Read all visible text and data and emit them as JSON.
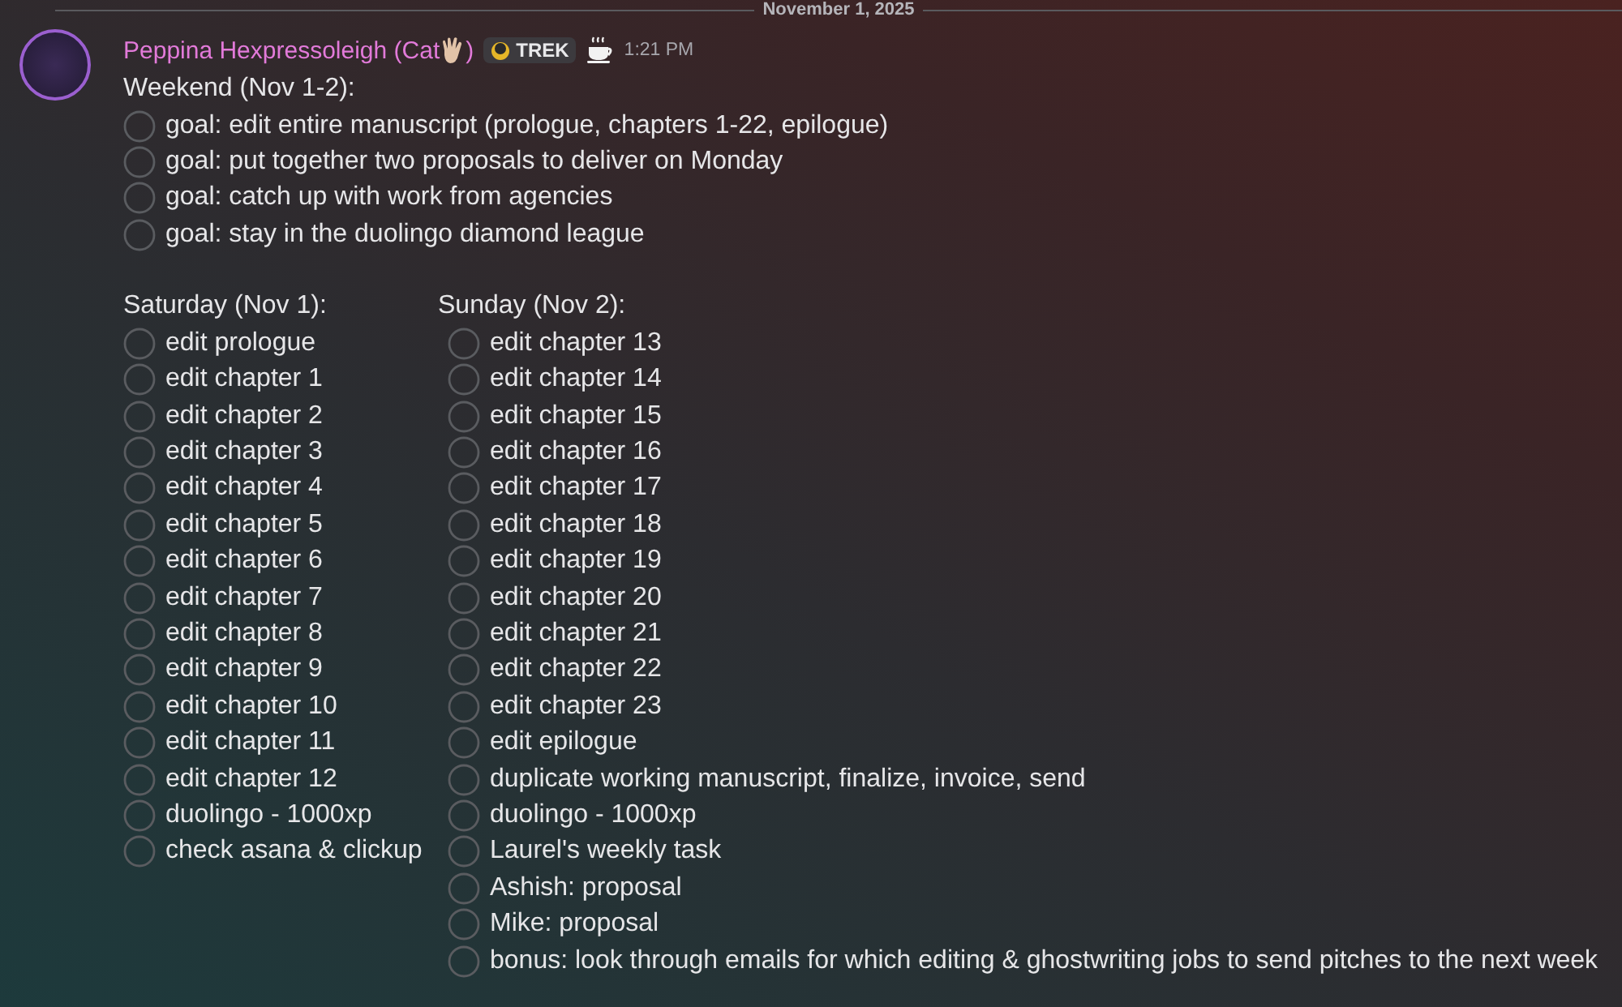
{
  "date_divider": "November 1, 2025",
  "message": {
    "author": "Peppina Hexpressoleigh (Cat",
    "author_end": ")",
    "tag": "TREK",
    "time": "1:21 PM",
    "heading": "Weekend (Nov 1-2):",
    "goals": [
      "goal: edit entire manuscript (prologue, chapters 1-22, epilogue)",
      "goal: put together two proposals to deliver on Monday",
      "goal: catch up with work from agencies",
      "goal: stay in the duolingo diamond league"
    ],
    "columns": [
      {
        "heading": "Saturday (Nov 1):",
        "items": [
          "edit prologue",
          "edit chapter 1",
          "edit chapter 2",
          "edit chapter 3",
          "edit chapter 4",
          "edit chapter 5",
          "edit chapter 6",
          "edit chapter 7",
          "edit chapter 8",
          "edit chapter 9",
          "edit chapter 10",
          "edit chapter 11",
          "edit chapter 12",
          "duolingo - 1000xp",
          "check asana & clickup"
        ]
      },
      {
        "heading": "Sunday (Nov 2):",
        "items": [
          "edit chapter 13",
          "edit chapter 14",
          "edit chapter 15",
          "edit chapter 16",
          "edit chapter 17",
          "edit chapter 18",
          "edit chapter 19",
          "edit chapter 20",
          "edit chapter 21",
          "edit chapter 22",
          "edit chapter 23",
          "edit epilogue",
          "duplicate working manuscript, finalize, invoice, send",
          "duolingo - 1000xp",
          "Laurel's weekly task",
          "Ashish: proposal",
          "Mike: proposal",
          "bonus: look through emails for which editing & ghostwriting jobs to send pitches to the next week"
        ]
      }
    ]
  }
}
